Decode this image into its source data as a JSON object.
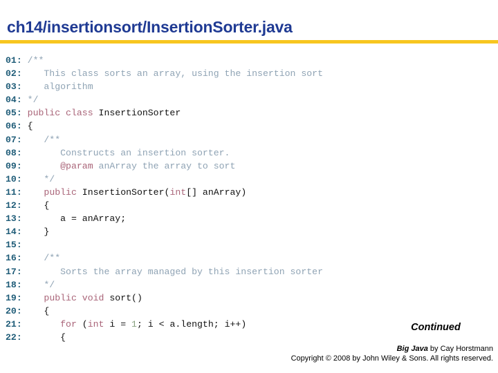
{
  "slide": {
    "title": "ch14/insertionsort/InsertionSorter.java",
    "accent_rule_color": "#F7C620",
    "title_color": "#1F3A93"
  },
  "colors": {
    "line_number": "#1F5C78",
    "keyword": "#A96478",
    "comment": "#8FA3B4",
    "number_literal": "#87A07F",
    "identifier": "#111111"
  },
  "code": {
    "language": "java",
    "lines": [
      {
        "no": "01:",
        "tokens": [
          {
            "t": "/**",
            "c": "cmt"
          }
        ]
      },
      {
        "no": "02:",
        "tokens": [
          {
            "t": "   This class sorts an array, using the insertion sort",
            "c": "cmt"
          }
        ]
      },
      {
        "no": "03:",
        "tokens": [
          {
            "t": "   algorithm",
            "c": "cmt"
          }
        ]
      },
      {
        "no": "04:",
        "tokens": [
          {
            "t": "*/",
            "c": "cmt"
          }
        ]
      },
      {
        "no": "05:",
        "tokens": [
          {
            "t": "public class ",
            "c": "kw"
          },
          {
            "t": "InsertionSorter",
            "c": "plain"
          }
        ]
      },
      {
        "no": "06:",
        "tokens": [
          {
            "t": "{",
            "c": "plain"
          }
        ]
      },
      {
        "no": "07:",
        "tokens": [
          {
            "t": "   /**",
            "c": "cmt"
          }
        ]
      },
      {
        "no": "08:",
        "tokens": [
          {
            "t": "      Constructs an insertion sorter.",
            "c": "cmt"
          }
        ]
      },
      {
        "no": "09:",
        "tokens": [
          {
            "t": "      ",
            "c": "cmt"
          },
          {
            "t": "@param",
            "c": "kw"
          },
          {
            "t": " anArray the array to sort",
            "c": "cmt"
          }
        ]
      },
      {
        "no": "10:",
        "tokens": [
          {
            "t": "   */",
            "c": "cmt"
          }
        ]
      },
      {
        "no": "11:",
        "tokens": [
          {
            "t": "   ",
            "c": "plain"
          },
          {
            "t": "public",
            "c": "kw"
          },
          {
            "t": " InsertionSorter(",
            "c": "plain"
          },
          {
            "t": "int",
            "c": "kw"
          },
          {
            "t": "[] anArray)",
            "c": "plain"
          }
        ]
      },
      {
        "no": "12:",
        "tokens": [
          {
            "t": "   {",
            "c": "plain"
          }
        ]
      },
      {
        "no": "13:",
        "tokens": [
          {
            "t": "      a = anArray;",
            "c": "plain"
          }
        ]
      },
      {
        "no": "14:",
        "tokens": [
          {
            "t": "   }",
            "c": "plain"
          }
        ]
      },
      {
        "no": "15:",
        "tokens": [
          {
            "t": "",
            "c": "plain"
          }
        ]
      },
      {
        "no": "16:",
        "tokens": [
          {
            "t": "   /**",
            "c": "cmt"
          }
        ]
      },
      {
        "no": "17:",
        "tokens": [
          {
            "t": "      Sorts the array managed by this insertion sorter",
            "c": "cmt"
          }
        ]
      },
      {
        "no": "18:",
        "tokens": [
          {
            "t": "   */",
            "c": "cmt"
          }
        ]
      },
      {
        "no": "19:",
        "tokens": [
          {
            "t": "   ",
            "c": "plain"
          },
          {
            "t": "public void ",
            "c": "kw"
          },
          {
            "t": "sort()",
            "c": "plain"
          }
        ]
      },
      {
        "no": "20:",
        "tokens": [
          {
            "t": "   {",
            "c": "plain"
          }
        ]
      },
      {
        "no": "21:",
        "tokens": [
          {
            "t": "      ",
            "c": "plain"
          },
          {
            "t": "for",
            "c": "kw"
          },
          {
            "t": " (",
            "c": "plain"
          },
          {
            "t": "int",
            "c": "kw"
          },
          {
            "t": " i = ",
            "c": "plain"
          },
          {
            "t": "1",
            "c": "num"
          },
          {
            "t": "; i < a.length; i++)",
            "c": "plain"
          }
        ]
      },
      {
        "no": "22:",
        "tokens": [
          {
            "t": "      {",
            "c": "plain"
          }
        ]
      }
    ]
  },
  "continued_label": "Continued",
  "footer": {
    "book_title": "Big Java",
    "byline": " by Cay Horstmann",
    "copyright": "Copyright © 2008 by John Wiley & Sons.  All rights reserved."
  }
}
